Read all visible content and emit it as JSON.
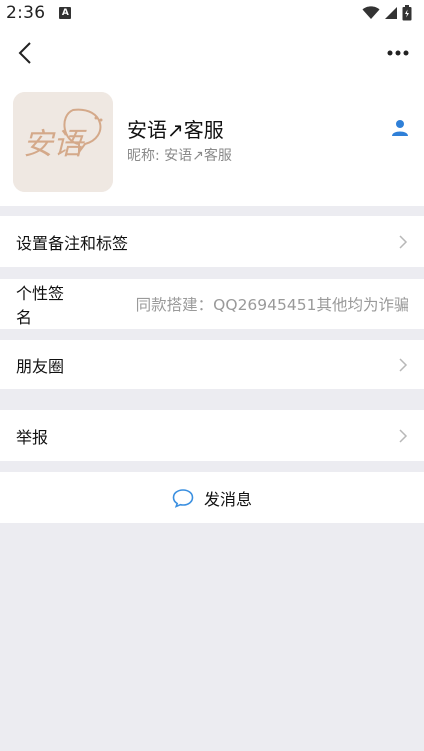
{
  "status_bar": {
    "time": "2:36",
    "indicator_letter": "A",
    "icons": [
      "wifi-icon",
      "signal-icon",
      "battery-icon"
    ]
  },
  "header": {
    "back_icon": "back-arrow-icon",
    "more_icon": "more-icon"
  },
  "profile": {
    "name": "安语↗客服",
    "nickname": "昵称: 安语↗客服",
    "avatar_text": "安语",
    "contact_icon": "person-icon",
    "accent_color": "#2f80d8"
  },
  "rows": {
    "remark": {
      "label": "设置备注和标签"
    },
    "signature": {
      "label": "个性签名",
      "value": "同款搭建：QQ26945451其他均为诈骗"
    },
    "moments": {
      "label": "朋友圈"
    },
    "report": {
      "label": "举报"
    }
  },
  "actions": {
    "send_message": "发消息"
  }
}
